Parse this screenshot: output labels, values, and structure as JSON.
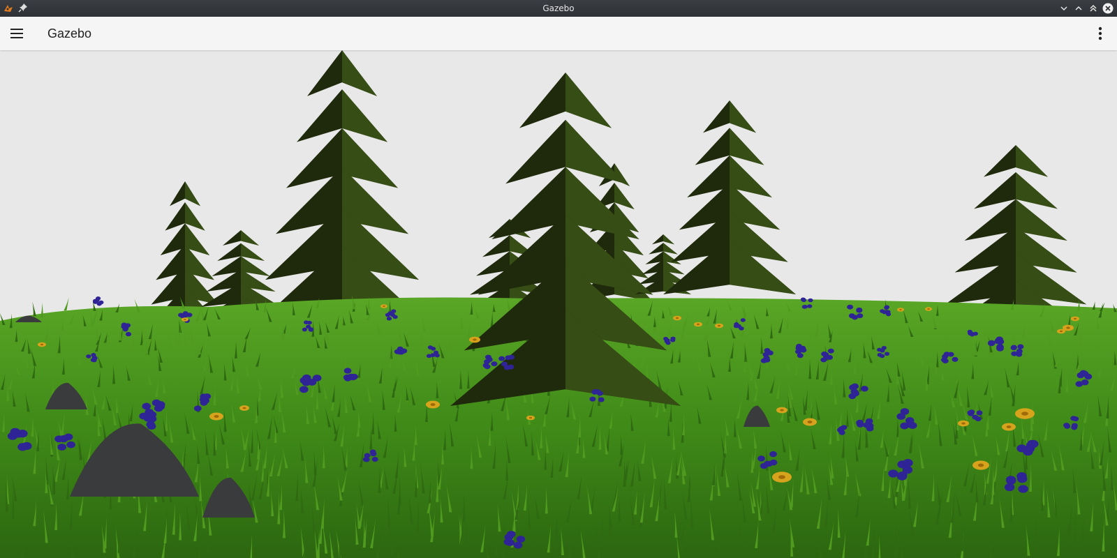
{
  "window": {
    "title": "Gazebo",
    "left_icons": [
      "gazebo-app-icon",
      "pin-icon"
    ],
    "right_controls": [
      "minimize-icon",
      "restore-icon",
      "maximize-icon",
      "close-icon"
    ]
  },
  "appbar": {
    "title": "Gazebo",
    "menu_icon": "hamburger-menu-icon",
    "overflow_icon": "more-vert-icon"
  },
  "scene": {
    "description_name": "3d-viewport",
    "colors": {
      "sky": "#e8e8e8",
      "grass_light": "#4f9a1f",
      "grass_dark": "#2f6a12",
      "tree_dark": "#1f2a0c",
      "tree_light": "#3f5a18",
      "flower_blue": "#2e2496",
      "flower_yellow": "#d8a31c",
      "rock": "#3a3b3d"
    }
  }
}
